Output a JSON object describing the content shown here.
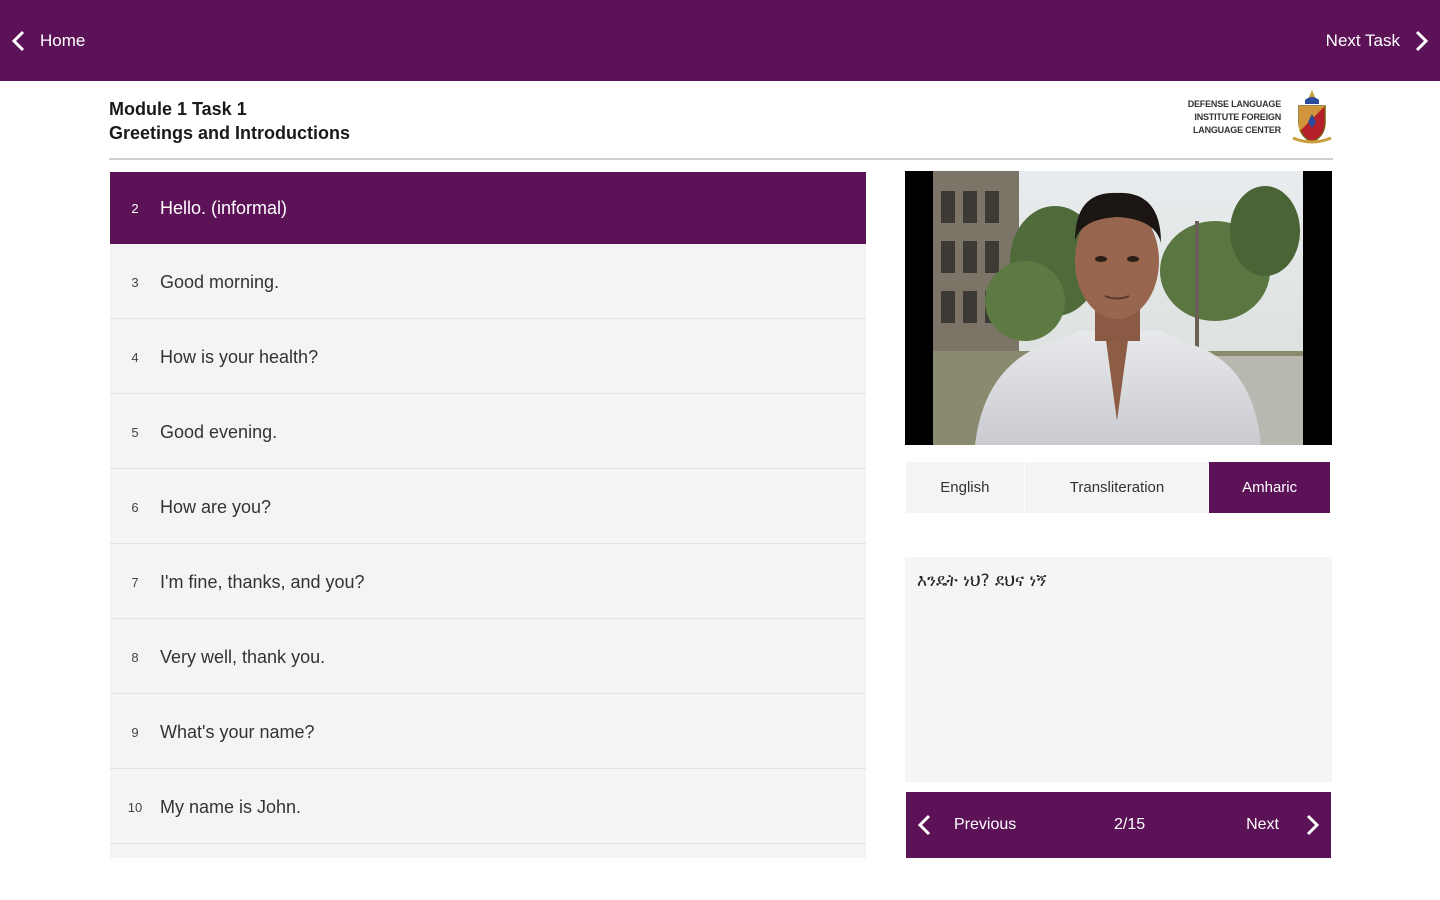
{
  "topbar": {
    "home_label": "Home",
    "next_task_label": "Next Task"
  },
  "header": {
    "module_title": "Module 1 Task 1",
    "module_subtitle": "Greetings and Introductions",
    "logo_lines": [
      "DEFENSE LANGUAGE",
      "INSTITUTE FOREIGN",
      "LANGUAGE CENTER"
    ]
  },
  "phrases": [
    {
      "num": "2",
      "text": "Hello. (informal)",
      "active": true
    },
    {
      "num": "3",
      "text": "Good morning."
    },
    {
      "num": "4",
      "text": "How is your health?"
    },
    {
      "num": "5",
      "text": "Good evening."
    },
    {
      "num": "6",
      "text": "How are you?"
    },
    {
      "num": "7",
      "text": "I'm fine, thanks, and you?"
    },
    {
      "num": "8",
      "text": "Very well, thank you."
    },
    {
      "num": "9",
      "text": "What's your name?"
    },
    {
      "num": "10",
      "text": "My name is John."
    }
  ],
  "tabs": {
    "english": "English",
    "transliteration": "Transliteration",
    "amharic": "Amharic",
    "selected": "Amharic"
  },
  "translation_text": "እንዴት ነህ? ደህና ነኝ",
  "pager": {
    "previous_label": "Previous",
    "count": "2/15",
    "next_label": "Next"
  },
  "colors": {
    "accent": "#5b1257",
    "row_bg": "#f4f4f4"
  }
}
